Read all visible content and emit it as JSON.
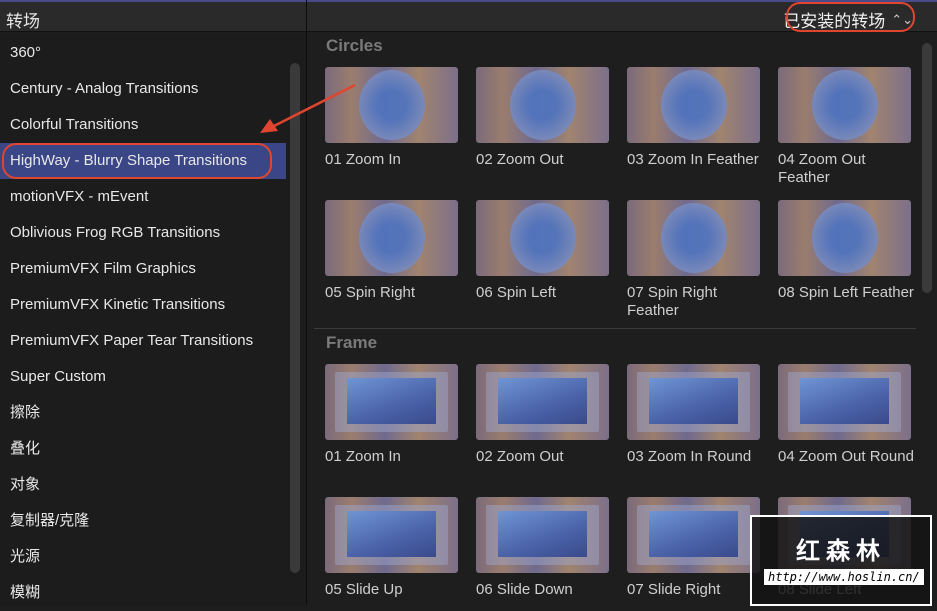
{
  "header": {
    "title": "转场",
    "dropdown": "已安装的转场",
    "dropdown_icon": "up-down-chevron-icon"
  },
  "sidebar": {
    "items": [
      "360°",
      "Century - Analog Transitions",
      "Colorful Transitions",
      "HighWay - Blurry Shape Transitions",
      "motionVFX - mEvent",
      "Oblivious Frog RGB Transitions",
      "PremiumVFX Film Graphics",
      "PremiumVFX Kinetic Transitions",
      "PremiumVFX Paper Tear Transitions",
      "Super Custom",
      "擦除",
      "叠化",
      "对象",
      "复制器/克隆",
      "光源",
      "模糊"
    ],
    "selected": 3
  },
  "sections": [
    {
      "title": "Circles",
      "items": [
        "01 Zoom In",
        "02 Zoom Out",
        "03 Zoom In Feather",
        "04 Zoom Out Feather",
        "05 Spin Right",
        "06 Spin Left",
        "07 Spin Right Feather",
        "08 Spin Left Feather"
      ]
    },
    {
      "title": "Frame",
      "items": [
        "01 Zoom In",
        "02 Zoom Out",
        "03 Zoom In Round",
        "04 Zoom Out Round",
        "05 Slide Up",
        "06 Slide Down",
        "07 Slide Right",
        "08 Slide Left"
      ]
    }
  ],
  "watermark": {
    "name": "红森林",
    "url": "http://www.hoslin.cn/"
  },
  "colors": {
    "selection": "#3a4686",
    "annotation": "#e0452f"
  }
}
